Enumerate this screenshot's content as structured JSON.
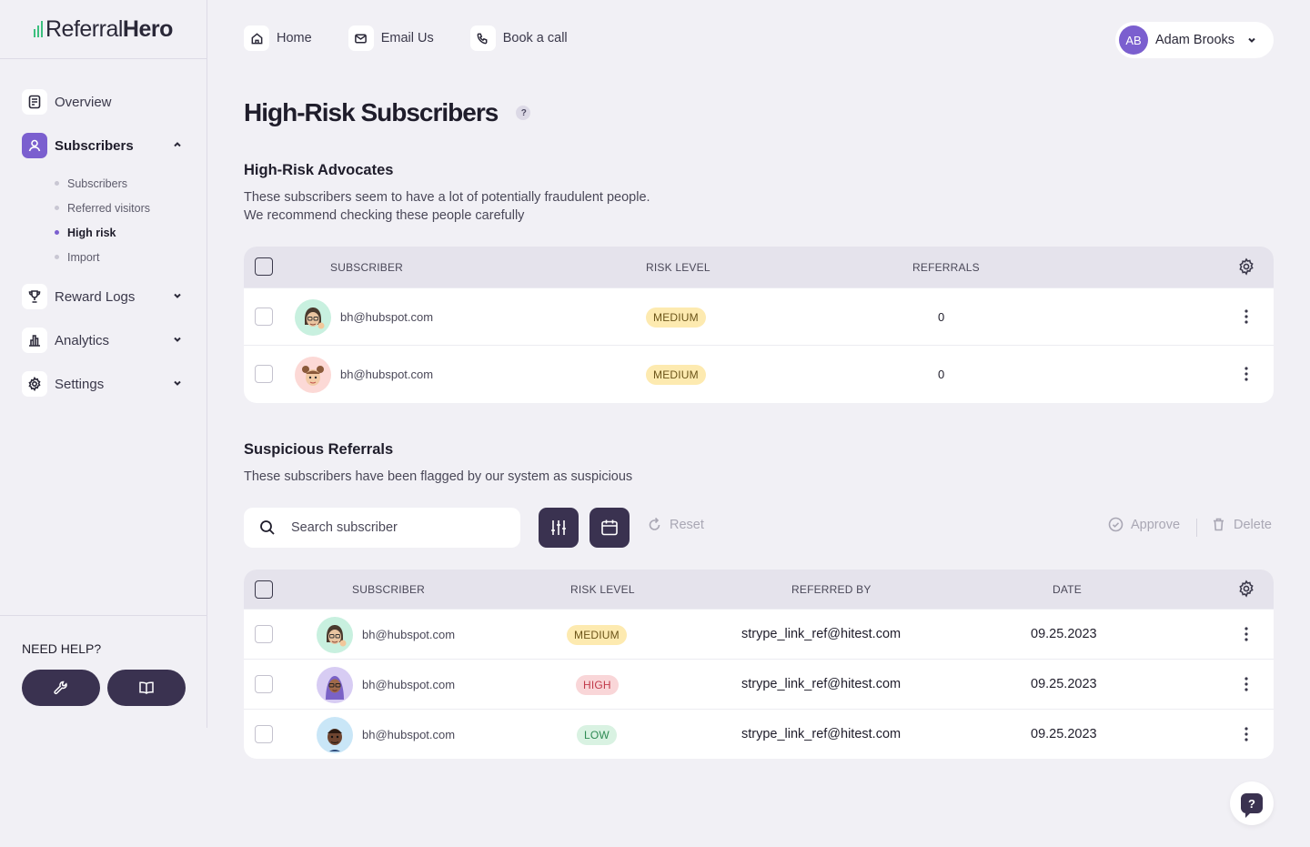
{
  "brand": {
    "part1": "Referral",
    "part2": "Hero",
    "bar_color": "#3cbf7e"
  },
  "sidebar": {
    "items": [
      {
        "label": "Overview",
        "icon": "clipboard-icon"
      },
      {
        "label": "Subscribers",
        "icon": "user-icon",
        "active": true
      },
      {
        "label": "Reward Logs",
        "icon": "trophy-icon"
      },
      {
        "label": "Analytics",
        "icon": "bar-chart-icon"
      },
      {
        "label": "Settings",
        "icon": "gear-icon"
      }
    ],
    "subitems": [
      {
        "label": "Subscribers"
      },
      {
        "label": "Referred visitors"
      },
      {
        "label": "High risk",
        "active": true
      },
      {
        "label": "Import"
      }
    ],
    "help_title": "NEED HELP?"
  },
  "topnav": {
    "home": "Home",
    "email": "Email Us",
    "call": "Book a call"
  },
  "user": {
    "initials": "AB",
    "name": "Adam Brooks"
  },
  "page": {
    "title": "High-Risk Subscribers",
    "help_badge": "?"
  },
  "advocates": {
    "title": "High-Risk Advocates",
    "desc_line1": "These subscribers seem to have a lot of potentially fraudulent people.",
    "desc_line2": "We recommend checking these people carefully",
    "columns": {
      "subscriber": "SUBSCRIBER",
      "risk": "RISK LEVEL",
      "referrals": "REFERRALS"
    },
    "rows": [
      {
        "email": "bh@hubspot.com",
        "risk": "MEDIUM",
        "referrals": "0"
      },
      {
        "email": "bh@hubspot.com",
        "risk": "MEDIUM",
        "referrals": "0"
      }
    ]
  },
  "suspicious": {
    "title": "Suspicious Referrals",
    "desc": "These subscribers have been flagged by our system as suspicious",
    "search_placeholder": "Search subscriber",
    "reset": "Reset",
    "approve": "Approve",
    "delete": "Delete",
    "columns": {
      "subscriber": "SUBSCRIBER",
      "risk": "RISK LEVEL",
      "referred_by": "REFERRED BY",
      "date": "DATE"
    },
    "rows": [
      {
        "email": "bh@hubspot.com",
        "risk": "MEDIUM",
        "referred_by": "strype_link_ref@hitest.com",
        "date": "09.25.2023"
      },
      {
        "email": "bh@hubspot.com",
        "risk": "HIGH",
        "referred_by": "strype_link_ref@hitest.com",
        "date": "09.25.2023"
      },
      {
        "email": "bh@hubspot.com",
        "risk": "LOW",
        "referred_by": "strype_link_ref@hitest.com",
        "date": "09.25.2023"
      }
    ]
  },
  "fab": {
    "label": "?"
  },
  "colors": {
    "accent": "#7b5fcf",
    "dark_button": "#3a3250",
    "background": "#f1f0f5"
  }
}
